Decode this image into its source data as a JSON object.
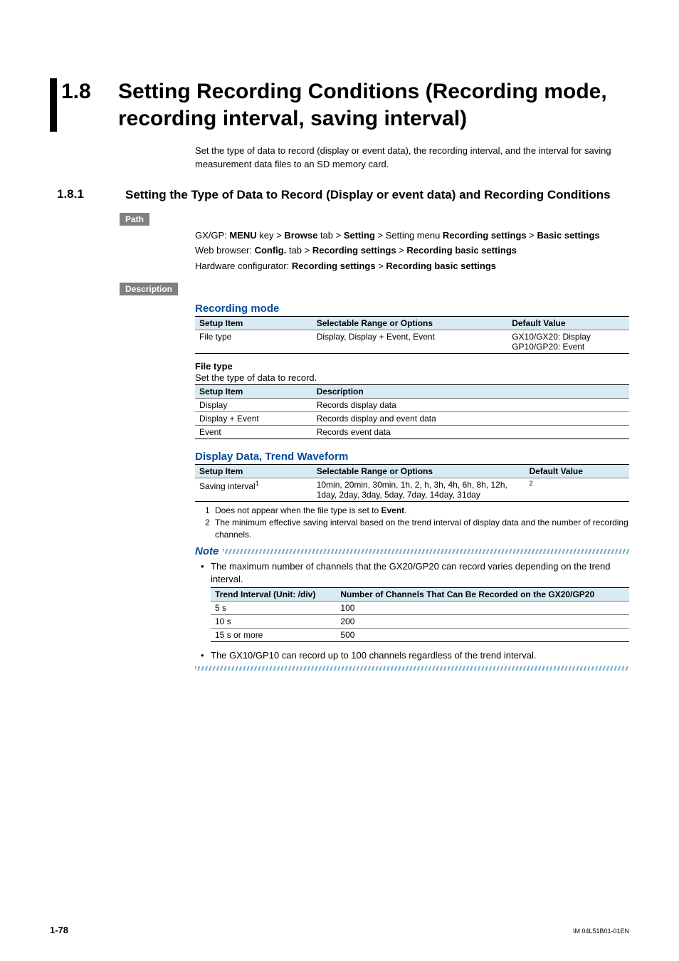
{
  "section": {
    "num": "1.8",
    "title": "Setting Recording Conditions (Recording mode, recording interval, saving interval)"
  },
  "lead": "Set the type of data to record (display or event data), the recording interval, and the interval for saving measurement data files to an SD memory card.",
  "subsection": {
    "num": "1.8.1",
    "title": "Setting the Type of Data to Record (Display or event data) and Recording Conditions"
  },
  "labels": {
    "path": "Path",
    "description": "Description",
    "note": "Note"
  },
  "path": {
    "l1_pre": "GX/GP: ",
    "l1_a": "MENU",
    "l1_b": " key > ",
    "l1_c": "Browse",
    "l1_d": " tab > ",
    "l1_e": "Setting",
    "l1_f": " > Setting menu ",
    "l1_g": "Recording settings",
    "l1_h": " > ",
    "l1_i": "Basic settings",
    "l2_pre": "Web browser: ",
    "l2_a": "Config.",
    "l2_b": " tab > ",
    "l2_c": "Recording settings",
    "l2_d": " > ",
    "l2_e": "Recording basic settings",
    "l3_pre": "Hardware configurator: ",
    "l3_a": "Recording settings",
    "l3_b": " > ",
    "l3_c": "Recording basic settings"
  },
  "recmode_heading": "Recording mode",
  "tbl_headers": {
    "setup": "Setup Item",
    "options": "Selectable Range or Options",
    "default": "Default Value",
    "desc": "Description"
  },
  "recmode_row": {
    "item": "File type",
    "options": "Display, Display + Event, Event",
    "def1": "GX10/GX20: Display",
    "def2": "GP10/GP20: Event"
  },
  "filetype_heading": "File type",
  "filetype_intro": "Set the type of data to record.",
  "filetype_rows": [
    {
      "item": "Display",
      "desc": "Records display data"
    },
    {
      "item": "Display + Event",
      "desc": "Records display and event data"
    },
    {
      "item": "Event",
      "desc": "Records event data"
    }
  ],
  "dispdata_heading": "Display Data, Trend Waveform",
  "disp_row": {
    "item_pre": "Saving interval",
    "item_sup": "1",
    "options": "10min, 20min, 30min, 1h, 2, h, 3h, 4h, 6h, 8h, 12h, 1day, 2day, 3day, 5day, 7day, 14day, 31day",
    "def_sup": "2"
  },
  "footnotes": {
    "f1_n": "1",
    "f1_a": "Does not appear when the file type is set to ",
    "f1_b": "Event",
    "f1_c": ".",
    "f2_n": "2",
    "f2": "The minimum effective saving interval based on the trend interval of display data and the number of recording channels."
  },
  "note_bullets": {
    "b1": "The maximum number of channels that the GX20/GP20 can record varies depending on the trend interval.",
    "b2": "The GX10/GP10 can record up to 100 channels regardless of the trend interval."
  },
  "trend_headers": {
    "c1": "Trend Interval (Unit: /div)",
    "c2": "Number of Channels That Can Be Recorded on the GX20/GP20"
  },
  "trend_rows": [
    {
      "a": "5 s",
      "b": "100"
    },
    {
      "a": "10 s",
      "b": "200"
    },
    {
      "a": "15 s or more",
      "b": "500"
    }
  ],
  "footer": {
    "page": "1-78",
    "doc": "IM 04L51B01-01EN"
  }
}
